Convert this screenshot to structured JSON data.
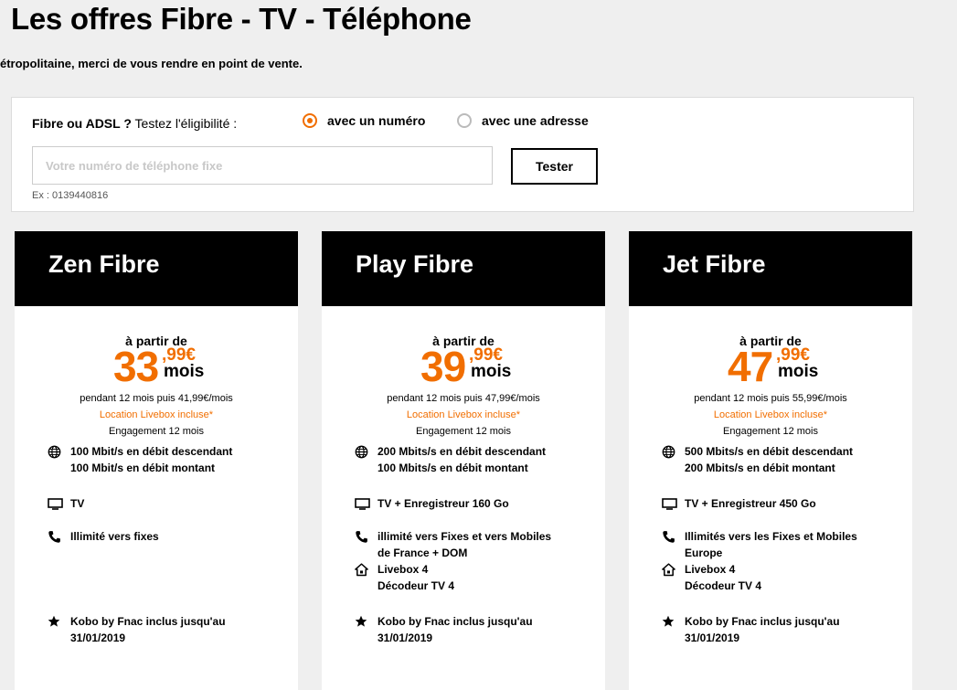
{
  "header": {
    "title": "Les offres Fibre - TV - Téléphone",
    "notice": "étropolitaine, merci de vous rendre en point de vente."
  },
  "eligibility": {
    "label_bold": "Fibre ou ADSL ?",
    "label_rest": " Testez l'éligibilité :",
    "option_number": "avec un numéro",
    "option_address": "avec une adresse",
    "selected": "number",
    "placeholder": "Votre numéro de téléphone fixe",
    "value": "",
    "button": "Tester",
    "example": "Ex : 0139440816"
  },
  "colors": {
    "accent": "#f16e00",
    "header_bg": "#000000",
    "page_bg": "#efefef"
  },
  "offers": [
    {
      "name": "Zen Fibre",
      "from": "à partir de",
      "price_int": "33",
      "price_cents": ",99€",
      "period": "mois",
      "then": "pendant 12 mois puis 41,99€/mois",
      "livebox": "Location Livebox incluse*",
      "engagement": "Engagement 12 mois",
      "features": {
        "internet": [
          "100 Mbit/s en débit descendant",
          "100 Mbit/s en débit montant"
        ],
        "tv": [
          "TV"
        ],
        "phone": [
          "Illimité vers fixes"
        ],
        "box": [],
        "kobo": [
          "Kobo by Fnac inclus jusqu'au",
          "31/01/2019"
        ]
      }
    },
    {
      "name": "Play Fibre",
      "from": "à partir de",
      "price_int": "39",
      "price_cents": ",99€",
      "period": "mois",
      "then": "pendant 12 mois puis 47,99€/mois",
      "livebox": "Location Livebox incluse*",
      "engagement": "Engagement 12 mois",
      "features": {
        "internet": [
          "200 Mbits/s en débit descendant",
          "100 Mbits/s en débit montant"
        ],
        "tv": [
          "TV + Enregistreur 160 Go"
        ],
        "phone": [
          "illimité vers Fixes et vers Mobiles",
          "de France + DOM"
        ],
        "box": [
          "Livebox 4",
          "Décodeur TV 4"
        ],
        "kobo": [
          "Kobo by Fnac inclus jusqu'au",
          "31/01/2019"
        ]
      }
    },
    {
      "name": "Jet Fibre",
      "from": "à partir de",
      "price_int": "47",
      "price_cents": ",99€",
      "period": "mois",
      "then": "pendant 12 mois puis 55,99€/mois",
      "livebox": "Location Livebox incluse*",
      "engagement": "Engagement 12 mois",
      "features": {
        "internet": [
          "500 Mbits/s en débit descendant",
          "200 Mbits/s en débit montant"
        ],
        "tv": [
          "TV + Enregistreur 450 Go"
        ],
        "phone": [
          "Illimités vers les Fixes et Mobiles",
          "Europe"
        ],
        "box": [
          "Livebox 4",
          "Décodeur TV 4"
        ],
        "kobo": [
          "Kobo by Fnac inclus jusqu'au",
          "31/01/2019"
        ]
      }
    }
  ]
}
